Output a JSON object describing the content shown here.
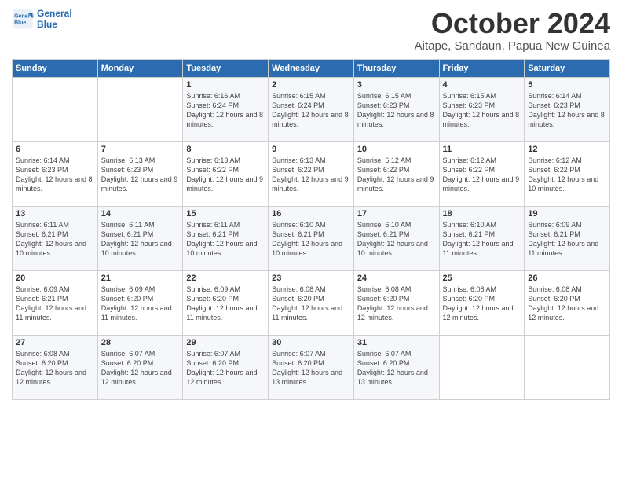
{
  "logo": {
    "line1": "General",
    "line2": "Blue"
  },
  "title": "October 2024",
  "location": "Aitape, Sandaun, Papua New Guinea",
  "days_header": [
    "Sunday",
    "Monday",
    "Tuesday",
    "Wednesday",
    "Thursday",
    "Friday",
    "Saturday"
  ],
  "weeks": [
    [
      {
        "day": "",
        "sunrise": "",
        "sunset": "",
        "daylight": ""
      },
      {
        "day": "",
        "sunrise": "",
        "sunset": "",
        "daylight": ""
      },
      {
        "day": "1",
        "sunrise": "Sunrise: 6:16 AM",
        "sunset": "Sunset: 6:24 PM",
        "daylight": "Daylight: 12 hours and 8 minutes."
      },
      {
        "day": "2",
        "sunrise": "Sunrise: 6:15 AM",
        "sunset": "Sunset: 6:24 PM",
        "daylight": "Daylight: 12 hours and 8 minutes."
      },
      {
        "day": "3",
        "sunrise": "Sunrise: 6:15 AM",
        "sunset": "Sunset: 6:23 PM",
        "daylight": "Daylight: 12 hours and 8 minutes."
      },
      {
        "day": "4",
        "sunrise": "Sunrise: 6:15 AM",
        "sunset": "Sunset: 6:23 PM",
        "daylight": "Daylight: 12 hours and 8 minutes."
      },
      {
        "day": "5",
        "sunrise": "Sunrise: 6:14 AM",
        "sunset": "Sunset: 6:23 PM",
        "daylight": "Daylight: 12 hours and 8 minutes."
      }
    ],
    [
      {
        "day": "6",
        "sunrise": "Sunrise: 6:14 AM",
        "sunset": "Sunset: 6:23 PM",
        "daylight": "Daylight: 12 hours and 8 minutes."
      },
      {
        "day": "7",
        "sunrise": "Sunrise: 6:13 AM",
        "sunset": "Sunset: 6:23 PM",
        "daylight": "Daylight: 12 hours and 9 minutes."
      },
      {
        "day": "8",
        "sunrise": "Sunrise: 6:13 AM",
        "sunset": "Sunset: 6:22 PM",
        "daylight": "Daylight: 12 hours and 9 minutes."
      },
      {
        "day": "9",
        "sunrise": "Sunrise: 6:13 AM",
        "sunset": "Sunset: 6:22 PM",
        "daylight": "Daylight: 12 hours and 9 minutes."
      },
      {
        "day": "10",
        "sunrise": "Sunrise: 6:12 AM",
        "sunset": "Sunset: 6:22 PM",
        "daylight": "Daylight: 12 hours and 9 minutes."
      },
      {
        "day": "11",
        "sunrise": "Sunrise: 6:12 AM",
        "sunset": "Sunset: 6:22 PM",
        "daylight": "Daylight: 12 hours and 9 minutes."
      },
      {
        "day": "12",
        "sunrise": "Sunrise: 6:12 AM",
        "sunset": "Sunset: 6:22 PM",
        "daylight": "Daylight: 12 hours and 10 minutes."
      }
    ],
    [
      {
        "day": "13",
        "sunrise": "Sunrise: 6:11 AM",
        "sunset": "Sunset: 6:21 PM",
        "daylight": "Daylight: 12 hours and 10 minutes."
      },
      {
        "day": "14",
        "sunrise": "Sunrise: 6:11 AM",
        "sunset": "Sunset: 6:21 PM",
        "daylight": "Daylight: 12 hours and 10 minutes."
      },
      {
        "day": "15",
        "sunrise": "Sunrise: 6:11 AM",
        "sunset": "Sunset: 6:21 PM",
        "daylight": "Daylight: 12 hours and 10 minutes."
      },
      {
        "day": "16",
        "sunrise": "Sunrise: 6:10 AM",
        "sunset": "Sunset: 6:21 PM",
        "daylight": "Daylight: 12 hours and 10 minutes."
      },
      {
        "day": "17",
        "sunrise": "Sunrise: 6:10 AM",
        "sunset": "Sunset: 6:21 PM",
        "daylight": "Daylight: 12 hours and 10 minutes."
      },
      {
        "day": "18",
        "sunrise": "Sunrise: 6:10 AM",
        "sunset": "Sunset: 6:21 PM",
        "daylight": "Daylight: 12 hours and 11 minutes."
      },
      {
        "day": "19",
        "sunrise": "Sunrise: 6:09 AM",
        "sunset": "Sunset: 6:21 PM",
        "daylight": "Daylight: 12 hours and 11 minutes."
      }
    ],
    [
      {
        "day": "20",
        "sunrise": "Sunrise: 6:09 AM",
        "sunset": "Sunset: 6:21 PM",
        "daylight": "Daylight: 12 hours and 11 minutes."
      },
      {
        "day": "21",
        "sunrise": "Sunrise: 6:09 AM",
        "sunset": "Sunset: 6:20 PM",
        "daylight": "Daylight: 12 hours and 11 minutes."
      },
      {
        "day": "22",
        "sunrise": "Sunrise: 6:09 AM",
        "sunset": "Sunset: 6:20 PM",
        "daylight": "Daylight: 12 hours and 11 minutes."
      },
      {
        "day": "23",
        "sunrise": "Sunrise: 6:08 AM",
        "sunset": "Sunset: 6:20 PM",
        "daylight": "Daylight: 12 hours and 11 minutes."
      },
      {
        "day": "24",
        "sunrise": "Sunrise: 6:08 AM",
        "sunset": "Sunset: 6:20 PM",
        "daylight": "Daylight: 12 hours and 12 minutes."
      },
      {
        "day": "25",
        "sunrise": "Sunrise: 6:08 AM",
        "sunset": "Sunset: 6:20 PM",
        "daylight": "Daylight: 12 hours and 12 minutes."
      },
      {
        "day": "26",
        "sunrise": "Sunrise: 6:08 AM",
        "sunset": "Sunset: 6:20 PM",
        "daylight": "Daylight: 12 hours and 12 minutes."
      }
    ],
    [
      {
        "day": "27",
        "sunrise": "Sunrise: 6:08 AM",
        "sunset": "Sunset: 6:20 PM",
        "daylight": "Daylight: 12 hours and 12 minutes."
      },
      {
        "day": "28",
        "sunrise": "Sunrise: 6:07 AM",
        "sunset": "Sunset: 6:20 PM",
        "daylight": "Daylight: 12 hours and 12 minutes."
      },
      {
        "day": "29",
        "sunrise": "Sunrise: 6:07 AM",
        "sunset": "Sunset: 6:20 PM",
        "daylight": "Daylight: 12 hours and 12 minutes."
      },
      {
        "day": "30",
        "sunrise": "Sunrise: 6:07 AM",
        "sunset": "Sunset: 6:20 PM",
        "daylight": "Daylight: 12 hours and 13 minutes."
      },
      {
        "day": "31",
        "sunrise": "Sunrise: 6:07 AM",
        "sunset": "Sunset: 6:20 PM",
        "daylight": "Daylight: 12 hours and 13 minutes."
      },
      {
        "day": "",
        "sunrise": "",
        "sunset": "",
        "daylight": ""
      },
      {
        "day": "",
        "sunrise": "",
        "sunset": "",
        "daylight": ""
      }
    ]
  ]
}
